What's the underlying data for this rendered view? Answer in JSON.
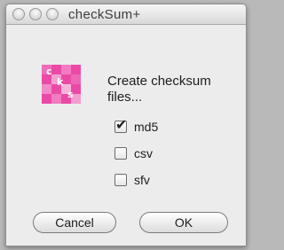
{
  "window": {
    "title": "checkSum+"
  },
  "icon": {
    "letters": [
      "c",
      "k",
      "s"
    ],
    "color": "#ea4aa6"
  },
  "dialog": {
    "message": "Create checksum files...",
    "options": [
      {
        "label": "md5",
        "checked": true
      },
      {
        "label": "csv",
        "checked": false
      },
      {
        "label": "sfv",
        "checked": false
      }
    ]
  },
  "buttons": {
    "cancel": "Cancel",
    "ok": "OK"
  }
}
